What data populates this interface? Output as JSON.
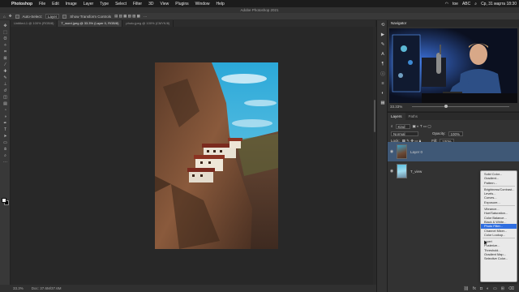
{
  "menubar": {
    "apple_symbol": "",
    "items": [
      "Photoshop",
      "File",
      "Edit",
      "Image",
      "Layer",
      "Type",
      "Select",
      "Filter",
      "3D",
      "View",
      "Plugins",
      "Window",
      "Help"
    ],
    "status_items": [
      "toe",
      "ABC",
      "Cp, 31 марта 18:30"
    ]
  },
  "window": {
    "title": "Adobe Photoshop 2021"
  },
  "options": {
    "auto_select_label": "Auto-Select:",
    "auto_select_value": "Layer",
    "transform_label": "Show Transform Controls"
  },
  "tabs": [
    {
      "label": "Untitled-1 @ 100% (RGB/8)",
      "active": false
    },
    {
      "label": "T_word.jpeg @ 33.3% (Layer 0, RGB/8)",
      "active": true
    },
    {
      "label": "photo.jpeg @ 100% (CMYK/8)",
      "active": false
    }
  ],
  "toolbar": {
    "tools": [
      "move-tool",
      "marquee-tool",
      "lasso-tool",
      "quick-select-tool",
      "crop-tool",
      "frame-tool",
      "eyedropper-tool",
      "healing-tool",
      "brush-tool",
      "stamp-tool",
      "history-brush-tool",
      "eraser-tool",
      "gradient-tool",
      "blur-tool",
      "dodge-tool",
      "pen-tool",
      "type-tool",
      "path-select-tool",
      "shape-tool",
      "hand-tool",
      "zoom-tool",
      "more-tools"
    ],
    "foreground_color": "#f2f2f2",
    "background_color": "#000000"
  },
  "status": {
    "zoom": "33.3%",
    "doc": "Doc: 37.6M/37.6M"
  },
  "navigator": {
    "tab_label": "Navigator",
    "zoom": "33.33%",
    "zoom_fraction": 0.33
  },
  "layers_panel": {
    "tabs": [
      "Layers",
      "Paths"
    ],
    "filter_label": "Kind",
    "blend_mode": "Normal",
    "opacity_label": "Opacity:",
    "opacity_value": "100%",
    "lock_label": "Lock:",
    "fill_label": "Fill:",
    "fill_value": "100%",
    "layers": [
      {
        "name": "Layer 0",
        "selected": true
      },
      {
        "name": "T_view",
        "selected": false
      }
    ]
  },
  "adjustment_menu": {
    "items": [
      "Solid Color...",
      "Gradient...",
      "Pattern...",
      "---",
      "Brightness/Contrast...",
      "Levels...",
      "Curves...",
      "Exposure...",
      "---",
      "Vibrance...",
      "Hue/Saturation...",
      "Color Balance...",
      "Black & White...",
      "Photo Filter...",
      "Channel Mixer...",
      "Color Lookup...",
      "---",
      "Invert",
      "Posterize...",
      "Threshold...",
      "Gradient Map...",
      "Selective Color..."
    ],
    "highlighted": "Photo Filter..."
  },
  "colors": {
    "accent": "#2f6ee0",
    "selected_layer": "#3f5876",
    "panel": "#323232",
    "canvas_bg": "#282828"
  }
}
